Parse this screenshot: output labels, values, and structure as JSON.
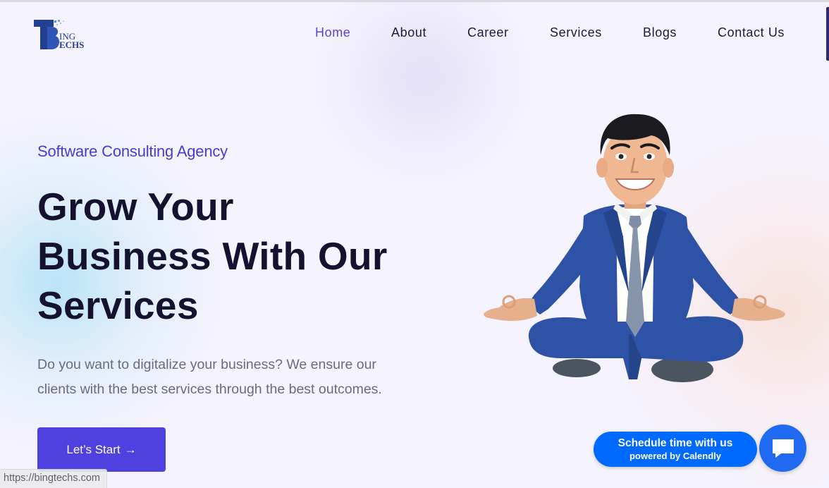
{
  "brand": {
    "logo_text_top": "ING",
    "logo_text_bottom": "ECHS"
  },
  "nav": {
    "items": [
      {
        "label": "Home",
        "active": true
      },
      {
        "label": "About"
      },
      {
        "label": "Career"
      },
      {
        "label": "Services"
      },
      {
        "label": "Blogs"
      },
      {
        "label": "Contact Us"
      }
    ]
  },
  "hero": {
    "tagline": "Software Consulting Agency",
    "headline_lines": [
      "Grow Your",
      "Business With Our",
      "Services"
    ],
    "description_lines": [
      "Do you want to digitalize your business? We ensure our",
      "clients with the best services through the best outcomes."
    ],
    "cta_label": "Let’s Start",
    "cta_arrow": "→"
  },
  "calendly": {
    "title": "Schedule time with us",
    "subtitle": "powered by Calendly"
  },
  "status_bar": {
    "url": "https://bingtechs.com"
  },
  "colors": {
    "accent": "#4f40e0",
    "nav_active": "#5a46d4",
    "heading": "#14122e",
    "calendly": "#0069ff",
    "chat": "#1f6af0"
  },
  "icons": {
    "chat": "chat-bubble-icon",
    "arrow": "arrow-right-icon"
  }
}
